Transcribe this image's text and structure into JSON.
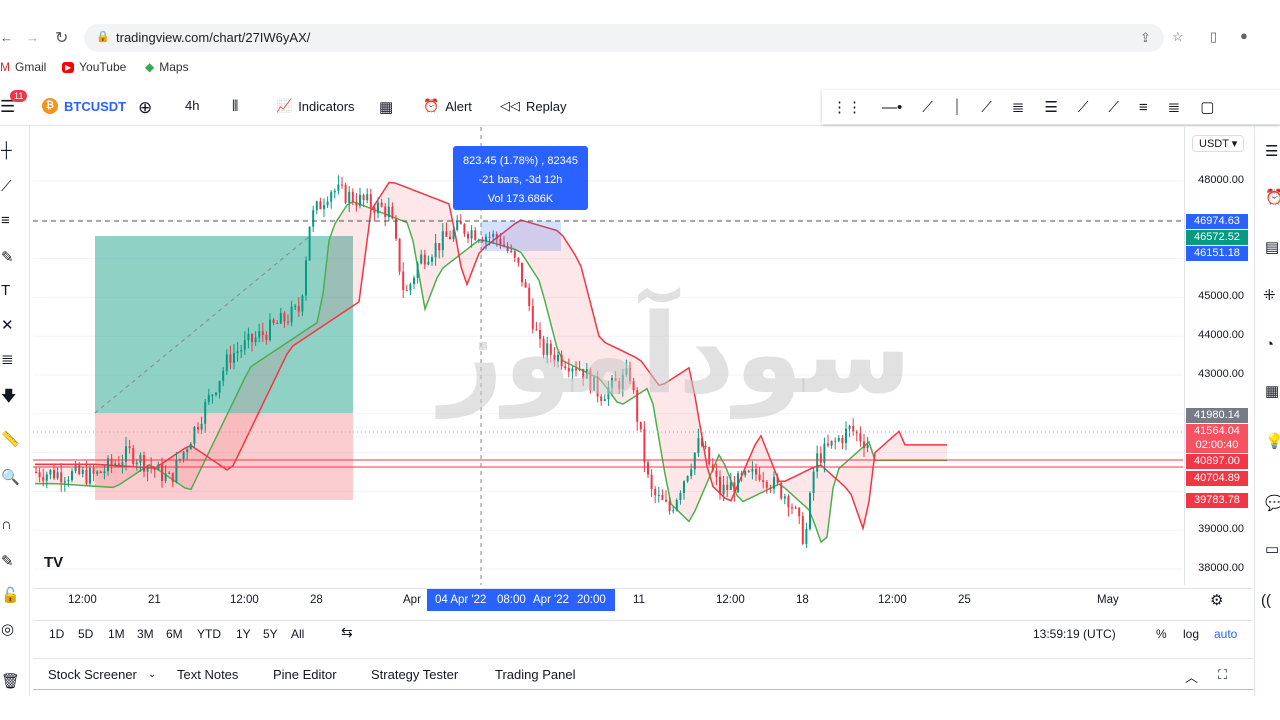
{
  "browser": {
    "url": "tradingview.com/chart/27IW6yAX/",
    "bookmarks": [
      "Gmail",
      "YouTube",
      "Maps"
    ]
  },
  "toolbar": {
    "notifications": "11",
    "symbol": "BTCUSDT",
    "interval": "4h",
    "indicators": "Indicators",
    "alert": "Alert",
    "replay": "Replay"
  },
  "tooltip": {
    "line1": "823.45 (1.78%) , 82345",
    "line2": "-21 bars, -3d 12h",
    "line3": "Vol 173.686K"
  },
  "watermark": "سودآموز",
  "price_axis": {
    "currency": "USDT",
    "ticks": [
      "48000.00",
      "45000.00",
      "44000.00",
      "43000.00",
      "39000.00",
      "38000.00"
    ],
    "labels": [
      {
        "text": "46974.63",
        "color": "#2962ff"
      },
      {
        "text": "46572.52",
        "color": "#089981"
      },
      {
        "text": "46151.18",
        "color": "#2962ff"
      },
      {
        "text": "41980.14",
        "color": "#787b86"
      },
      {
        "text": "41564.04",
        "color": "#f7525f"
      },
      {
        "text": "02:00:40",
        "color": "#f7525f"
      },
      {
        "text": "40897.00",
        "color": "#f23645"
      },
      {
        "text": "40704.89",
        "color": "#f23645"
      },
      {
        "text": "39783.78",
        "color": "#f23645"
      }
    ]
  },
  "time_axis": {
    "ticks": [
      "12:00",
      "21",
      "12:00",
      "28",
      "Apr",
      "11",
      "12:00",
      "18",
      "12:00",
      "25",
      "May"
    ],
    "selection": [
      "04 Apr '22",
      "08:00",
      "Apr '22",
      "20:00"
    ]
  },
  "ranges": {
    "items": [
      "1D",
      "5D",
      "1M",
      "3M",
      "6M",
      "YTD",
      "1Y",
      "5Y",
      "All"
    ],
    "clock": "13:59:19 (UTC)",
    "percent": "%",
    "log": "log",
    "auto": "auto"
  },
  "bottom_panel": {
    "tabs": [
      "Stock Screener",
      "Text Notes",
      "Pine Editor",
      "Strategy Tester",
      "Trading Panel"
    ]
  },
  "colors": {
    "accent": "#2962ff",
    "up": "#089981",
    "down": "#f23645"
  }
}
